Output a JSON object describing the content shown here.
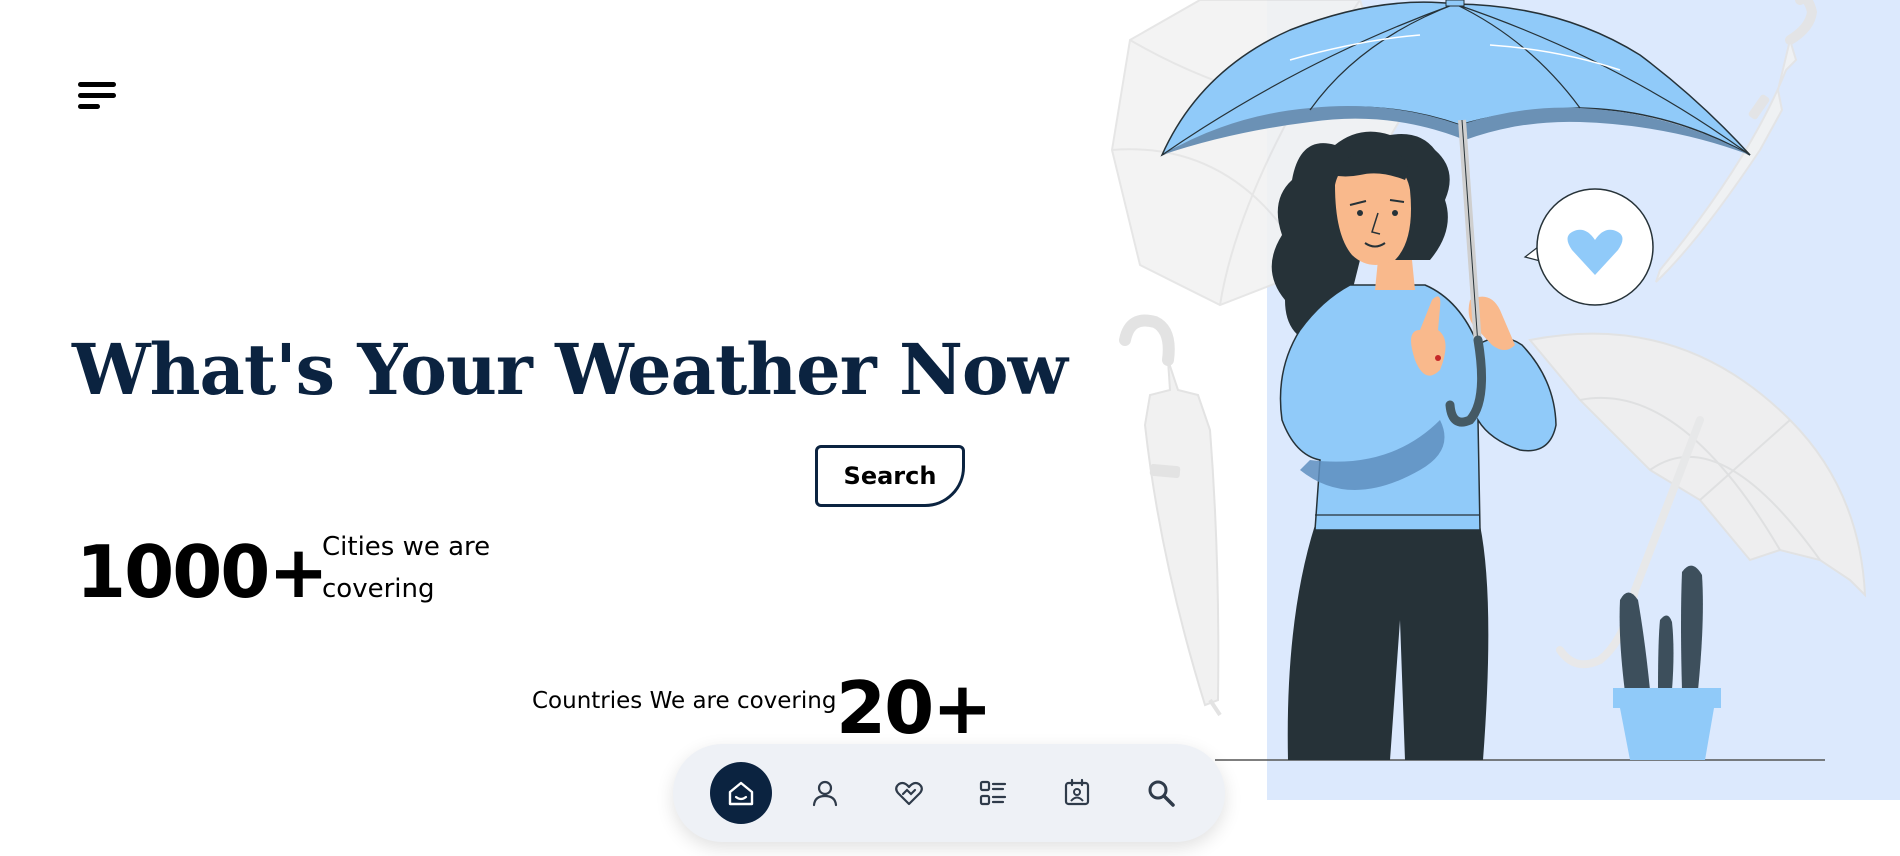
{
  "hero": {
    "title": "What's Your Weather Now",
    "search_label": "Search"
  },
  "stats": {
    "cities_value": "1000+",
    "cities_label": "Cities we are covering",
    "countries_label": "Countries We are covering",
    "countries_value": "20+"
  },
  "nav": {
    "active": "home",
    "items": [
      "home-icon",
      "profile-icon",
      "favorites-icon",
      "list-icon",
      "calendar-icon",
      "search-icon"
    ]
  },
  "colors": {
    "primary_dark": "#0b2340",
    "nav_bg": "#eef1f6",
    "illustration_bg": "#dce9fd",
    "umbrella_blue": "#90caf9",
    "figure_dark": "#263238"
  }
}
